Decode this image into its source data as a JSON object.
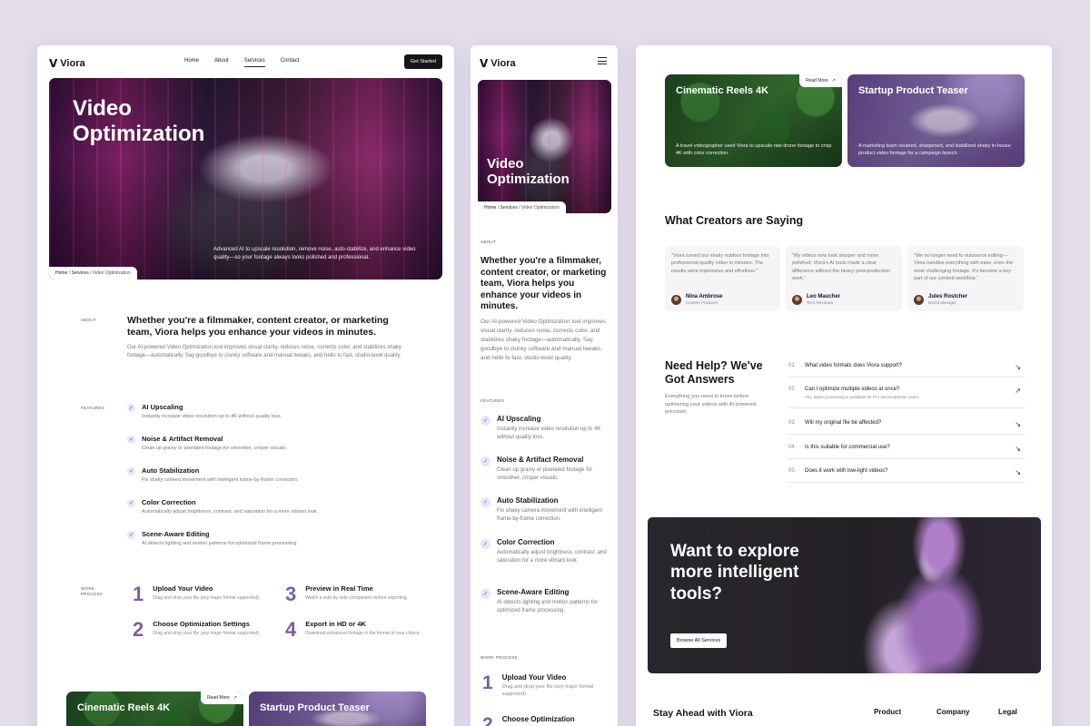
{
  "brand": {
    "name": "Viora",
    "mark": "V"
  },
  "desktop": {
    "nav": [
      "Home",
      "About",
      "Services",
      "Contact"
    ],
    "nav_active": "Services",
    "cta": "Get Started",
    "hero": {
      "title_line1": "Video",
      "title_line2": "Optimization",
      "subtitle": "Advanced AI to upscale resolution, remove noise, auto-stabilize, and enhance video quality—so your footage always looks polished and professional."
    },
    "breadcrumb": [
      "Home",
      "Services",
      "Video Optimization"
    ],
    "about": {
      "tag": "ABOUT",
      "title": "Whether you're a filmmaker, content creator, or marketing team, Viora helps you enhance your videos in minutes.",
      "body": "Our AI-powered Video Optimization tool improves visual clarity, reduces noise, corrects color, and stabilizes shaky footage—automatically. Say goodbye to clunky software and manual tweaks, and hello to fast, studio-level quality."
    },
    "features": {
      "tag": "FEATURES",
      "items": [
        {
          "title": "AI Upscaling",
          "desc": "Instantly increase video resolution up to 4K without quality loss."
        },
        {
          "title": "Noise & Artifact Removal",
          "desc": "Clean up grainy or pixelated footage for smoother, crisper visuals."
        },
        {
          "title": "Auto Stabilization",
          "desc": "Fix shaky camera movement with intelligent frame-by-frame correction."
        },
        {
          "title": "Color Correction",
          "desc": "Automatically adjust brightness, contrast, and saturation for a more vibrant look."
        },
        {
          "title": "Scene-Aware Editing",
          "desc": "AI detects lighting and motion patterns for optimized frame processing."
        }
      ]
    },
    "process": {
      "tag_line1": "WORK",
      "tag_line2": "PROCESS",
      "steps": [
        {
          "num": "1",
          "title": "Upload Your Video",
          "desc": "Drag and drop your file (any major format supported)."
        },
        {
          "num": "2",
          "title": "Choose Optimization Settings",
          "desc": "Drag and drop your file (any major format supported)."
        },
        {
          "num": "3",
          "title": "Preview in Real Time",
          "desc": "Watch a side-by-side comparison before exporting."
        },
        {
          "num": "4",
          "title": "Export in HD or 4K",
          "desc": "Download enhanced footage in the format of your choice."
        }
      ]
    },
    "cards": [
      {
        "title": "Cinematic Reels 4K"
      },
      {
        "title": "Startup Product Teaser"
      }
    ],
    "read_more": "Read More"
  },
  "mobile": {
    "hero": {
      "title_line1": "Video",
      "title_line2": "Optimization"
    },
    "breadcrumb": [
      "Home",
      "Services",
      "Video Optimization"
    ],
    "about": {
      "tag": "ABOUT",
      "title": "Whether you're a filmmaker, content creator, or marketing team, Viora helps you enhance your videos in minutes.",
      "body": "Our AI-powered Video Optimization tool improves visual clarity, reduces noise, corrects color, and stabilizes shaky footage—automatically. Say goodbye to clunky software and manual tweaks, and hello to fast, studio-level quality."
    },
    "features": {
      "tag": "FEATURES",
      "items": [
        {
          "title": "AI Upscaling",
          "desc": "Instantly increase video resolution up to 4K without quality loss."
        },
        {
          "title": "Noise & Artifact Removal",
          "desc": "Clean up grainy or pixelated footage for smoother, crisper visuals."
        },
        {
          "title": "Auto Stabilization",
          "desc": "Fix shaky camera movement with intelligent frame-by-frame correction."
        },
        {
          "title": "Color Correction",
          "desc": "Automatically adjust brightness, contrast, and saturation for a more vibrant look."
        },
        {
          "title": "Scene-Aware Editing",
          "desc": "AI detects lighting and motion patterns for optimized frame processing."
        }
      ]
    },
    "process": {
      "tag": "WORK PROCESS",
      "steps": [
        {
          "num": "1",
          "title": "Upload Your Video",
          "desc": "Drag and drop your file (any major format supported)."
        },
        {
          "num": "2",
          "title": "Choose Optimization"
        }
      ]
    }
  },
  "right": {
    "cards": [
      {
        "title": "Cinematic Reels 4K",
        "desc": "A travel videographer used Viora to upscale raw drone footage to crisp 4K with color correction."
      },
      {
        "title": "Startup Product Teaser",
        "desc": "A marketing team cleaned, sharpened, and stabilized shaky in-house product video footage for a campaign launch."
      }
    ],
    "read_more": "Read More",
    "testimonials": {
      "title": "What Creators are Saying",
      "items": [
        {
          "quote": "\"Viora turned our shaky outdoor footage into professional-quality video in minutes. The results were impressive and effortless.\"",
          "name": "Nina Ambrose",
          "role": "Content Producer"
        },
        {
          "quote": "\"My videos now look sharper and more polished. Viora's AI tools made a clear difference without the heavy post-production work.\"",
          "name": "Leo Maucher",
          "role": "Tech Reviewer"
        },
        {
          "quote": "\"We no longer need to outsource editing—Viora handles everything with ease, even the most challenging footage. It's become a key part of our content workflow.\"",
          "name": "Jules Rostcher",
          "role": "Brand Manager"
        }
      ]
    },
    "faq": {
      "title_line1": "Need Help? We've",
      "title_line2": "Got Answers",
      "intro": "Everything you need to know before optimizing your videos with AI-powered precision.",
      "items": [
        {
          "num": "01",
          "q": "What video formats does Viora support?",
          "a": ""
        },
        {
          "num": "02",
          "q": "Can I optimize multiple videos at once?",
          "a": "Yes, batch processing is available for Pro and Enterprise users"
        },
        {
          "num": "03",
          "q": "Will my original file be affected?",
          "a": ""
        },
        {
          "num": "04",
          "q": "Is this suitable for commercial use?",
          "a": ""
        },
        {
          "num": "05",
          "q": "Does it work with low-light videos?",
          "a": ""
        }
      ]
    },
    "banner": {
      "title_line1": "Want to explore",
      "title_line2": "more intelligent",
      "title_line3": "tools?",
      "button": "Browse All Services"
    },
    "footer": {
      "newsletter_title": "Stay Ahead with Viora",
      "columns": [
        "Product",
        "Company",
        "Legal"
      ]
    }
  }
}
